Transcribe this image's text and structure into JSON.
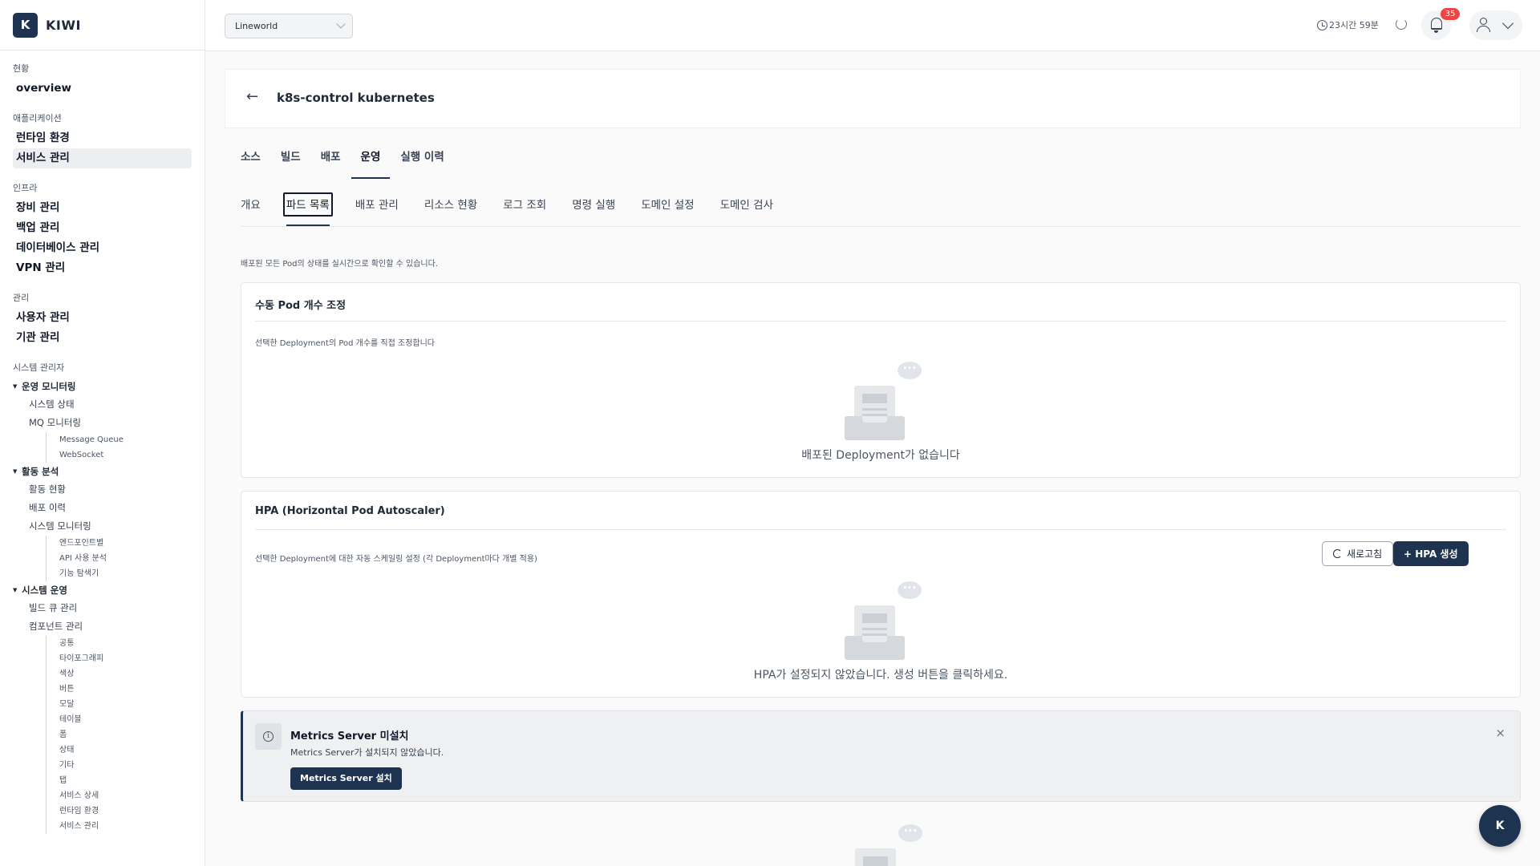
{
  "brand": {
    "logo_letter": "K",
    "name": "KIWI"
  },
  "sidebar": {
    "sections": [
      {
        "title": "현황",
        "items": [
          "overview"
        ]
      },
      {
        "title": "애플리케이션",
        "items": [
          "런타임 환경",
          "서비스 관리"
        ],
        "active": "서비스 관리"
      },
      {
        "title": "인프라",
        "items": [
          "장비 관리",
          "백업 관리",
          "데이터베이스 관리",
          "VPN 관리"
        ]
      },
      {
        "title": "관리",
        "items": [
          "사용자 관리",
          "기관 관리"
        ]
      }
    ],
    "sysadmin_title": "시스템 관리자",
    "groups": [
      {
        "title": "운영 모니터링",
        "items": [
          {
            "label": "시스템 상태"
          },
          {
            "label": "MQ 모니터링",
            "children": [
              "Message Queue",
              "WebSocket"
            ]
          }
        ]
      },
      {
        "title": "활동 분석",
        "items": [
          {
            "label": "활동 현황"
          },
          {
            "label": "배포 이력"
          },
          {
            "label": "시스템 모니터링",
            "children": [
              "엔드포인트별",
              "API 사용 분석",
              "기능 탐색기"
            ]
          }
        ]
      },
      {
        "title": "시스템 운영",
        "items": [
          {
            "label": "빌드 큐 관리"
          },
          {
            "label": "컴포넌트 관리",
            "children": [
              "공통",
              "타이포그래피",
              "색상",
              "버튼",
              "모달",
              "테이블",
              "폼",
              "상태",
              "기타",
              "탭",
              "서비스 상세",
              "런타임 환경",
              "서비스 관리"
            ]
          }
        ]
      }
    ]
  },
  "topbar": {
    "project": "Lineworld",
    "session_time": "23시간 59분",
    "notification_count": "35"
  },
  "page": {
    "title": "k8s-control kubernetes",
    "primary_tabs": [
      "소스",
      "빌드",
      "배포",
      "운영",
      "실행 이력"
    ],
    "primary_active": 3,
    "secondary_tabs": [
      "개요",
      "파드 목록",
      "배포 관리",
      "리소스 현황",
      "로그 조회",
      "명령 실행",
      "도메인 설정",
      "도메인 검사"
    ],
    "secondary_active": 1,
    "description": "배포된 모든 Pod의 상태를 실시간으로 확인할 수 있습니다."
  },
  "manual_card": {
    "title": "수동 Pod 개수 조정",
    "description": "선택한 Deployment의 Pod 개수를 직접 조정합니다",
    "empty_text": "배포된 Deployment가 없습니다"
  },
  "hpa_card": {
    "title": "HPA (Horizontal Pod Autoscaler)",
    "description": "선택한 Deployment에 대한 자동 스케일링 설정 (각 Deployment마다 개별 적용)",
    "refresh_label": "새로고침",
    "create_label": "+ HPA 생성",
    "empty_text": "HPA가 설정되지 않았습니다. 생성 버튼을 클릭하세요."
  },
  "alert": {
    "title": "Metrics Server 미설치",
    "message": "Metrics Server가 설치되지 않았습니다.",
    "button": "Metrics Server 설치",
    "close": "×"
  },
  "fab_label": "K",
  "colors": {
    "primary": "#1e3350",
    "badge": "#ef4444"
  },
  "icons": [
    "clock-icon",
    "refresh-icon",
    "bell-icon",
    "user-icon",
    "chevron-down-icon",
    "back-arrow-icon",
    "info-icon",
    "close-icon",
    "empty-tray-icon"
  ]
}
